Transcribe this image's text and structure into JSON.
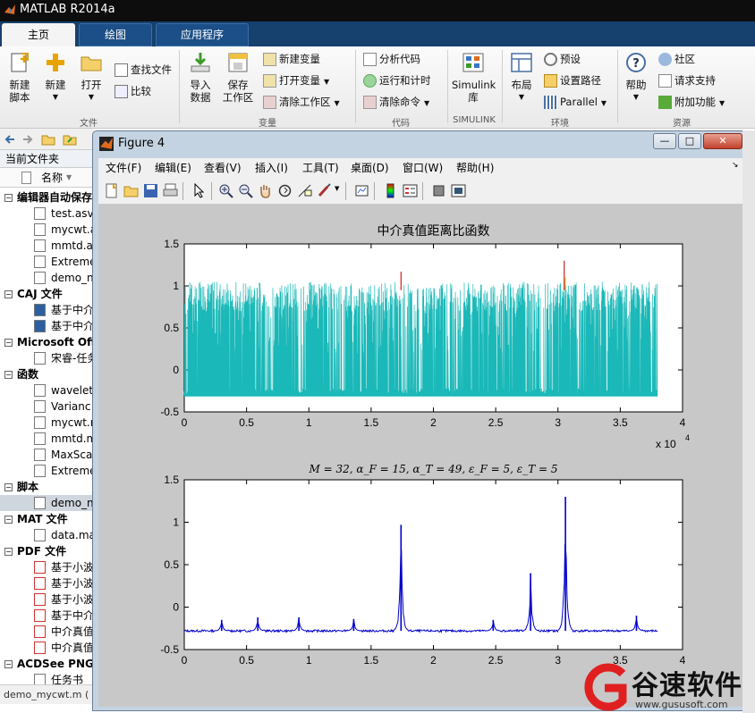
{
  "app": {
    "title": "MATLAB R2014a"
  },
  "tabs": [
    {
      "label": "主页",
      "active": true
    },
    {
      "label": "绘图",
      "active": false
    },
    {
      "label": "应用程序",
      "active": false
    }
  ],
  "ribbon": {
    "new_script": [
      "新建",
      "脚本"
    ],
    "new": "新建",
    "open": "打开",
    "find_files": "查找文件",
    "compare": "比较",
    "group_file": "文件",
    "import": [
      "导入",
      "数据"
    ],
    "save_ws": [
      "保存",
      "工作区"
    ],
    "new_var": "新建变量",
    "open_var": "打开变量",
    "clear_ws": "清除工作区",
    "group_var": "变量",
    "analyze": "分析代码",
    "run_time": "运行和计时",
    "clear_cmd": "清除命令",
    "group_code": "代码",
    "simulink": [
      "Simulink",
      "库"
    ],
    "group_simulink": "SIMULINK",
    "layout": "布局",
    "preferences": "预设",
    "set_path": "设置路径",
    "parallel": "Parallel",
    "group_env": "环境",
    "help": "帮助",
    "community": "社区",
    "support": "请求支持",
    "addons": "附加功能",
    "group_resources": "资源"
  },
  "browser": {
    "current_folder": "当前文件夹",
    "name_col": "名称",
    "sections": [
      {
        "label": "编辑器自动保存",
        "items": [
          "test.asv",
          "mycwt.a",
          "mmtd.a",
          "Extreme",
          "demo_n"
        ]
      },
      {
        "label": "CAJ 文件",
        "items": [
          "基于中介",
          "基于中介"
        ]
      },
      {
        "label": "Microsoft Off",
        "items": [
          "宋睿-任务"
        ]
      },
      {
        "label": "函数",
        "items": [
          "wavelet",
          "Varianc",
          "mycwt.m",
          "mmtd.m",
          "MaxSca",
          "Extreme"
        ]
      },
      {
        "label": "脚本",
        "items": [
          "demo_n"
        ]
      },
      {
        "label": "MAT 文件",
        "items": [
          "data.ma"
        ]
      },
      {
        "label": "PDF 文件",
        "items": [
          "基于小波",
          "基于小波",
          "基于小波",
          "基于中介",
          "中介真值",
          "中介真值"
        ]
      },
      {
        "label": "ACDSee PNG",
        "items": [
          "任务书"
        ]
      }
    ],
    "status": "demo_mycwt.m ("
  },
  "figure": {
    "title": "Figure 4",
    "menus": [
      "文件(F)",
      "编辑(E)",
      "查看(V)",
      "插入(I)",
      "工具(T)",
      "桌面(D)",
      "窗口(W)",
      "帮助(H)"
    ],
    "controls": [
      "—",
      "□",
      "✕"
    ]
  },
  "chart_data": [
    {
      "type": "line",
      "title": "中介真值距离比函数",
      "xlim": [
        0,
        40000
      ],
      "ylim": [
        -0.5,
        1.5
      ],
      "xticks": [
        "0",
        "0.5",
        "1",
        "1.5",
        "2",
        "2.5",
        "3",
        "3.5",
        "4"
      ],
      "yticks": [
        "1.5",
        "1",
        "0.5",
        "0",
        "-0.5"
      ],
      "x_exponent": "x 10",
      "x_exponent_power": "4",
      "series": [
        {
          "color": "#1ab8b8",
          "description": "dense oscillations between -0.3 and 1.0 with peaks up to 1.3"
        }
      ],
      "burst_centers": [
        1200,
        3000,
        5000,
        8200,
        10800,
        13700,
        16500,
        20000,
        23300,
        24600,
        26500,
        30500,
        33000,
        35000,
        36500
      ],
      "accent_spikes": [
        {
          "x": 17400,
          "y": 1.17,
          "color": "#cc2222"
        },
        {
          "x": 30500,
          "y": 1.3,
          "color": "#cc2222"
        },
        {
          "x": 30600,
          "y": 1.1,
          "color": "#d8d020"
        }
      ]
    },
    {
      "type": "line",
      "title": "M = 32, α_F = 15, α_T = 49, ε_F = 5, ε_T = 5",
      "xlim": [
        0,
        40000
      ],
      "ylim": [
        -0.5,
        1.5
      ],
      "xticks": [
        "0",
        "0.5",
        "1",
        "1.5",
        "2",
        "2.5",
        "3",
        "3.5",
        "4"
      ],
      "yticks": [
        "1.5",
        "1",
        "0.5",
        "0",
        "-0.5"
      ],
      "baseline": -0.28,
      "peaks": [
        {
          "x": 3000,
          "y": -0.15
        },
        {
          "x": 5900,
          "y": -0.12
        },
        {
          "x": 9200,
          "y": -0.12
        },
        {
          "x": 13600,
          "y": -0.14
        },
        {
          "x": 17400,
          "y": 0.97
        },
        {
          "x": 24800,
          "y": -0.15
        },
        {
          "x": 27800,
          "y": 0.4
        },
        {
          "x": 30600,
          "y": 1.3
        },
        {
          "x": 36300,
          "y": -0.1
        }
      ],
      "series": [
        {
          "color": "#0000cc"
        }
      ]
    }
  ],
  "watermark": {
    "brand": "谷速软件",
    "url": "www.gususoft.com"
  }
}
